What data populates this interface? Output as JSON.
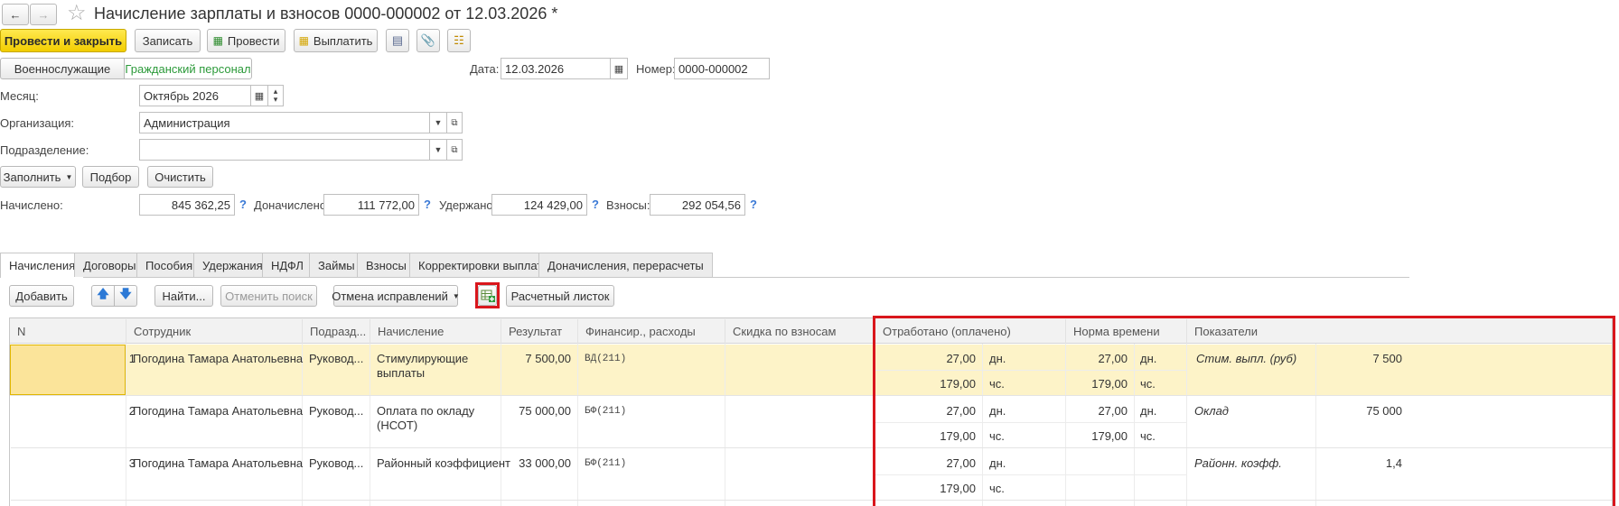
{
  "header": {
    "title": "Начисление зарплаты и взносов 0000-000002 от 12.03.2026 *"
  },
  "toolbar": {
    "post_close": "Провести и закрыть",
    "save": "Записать",
    "post": "Провести",
    "pay": "Выплатить"
  },
  "modes": {
    "military": "Военнослужащие",
    "civil": "Гражданский персонал"
  },
  "doc": {
    "date_label": "Дата:",
    "date_value": "12.03.2026",
    "number_label": "Номер:",
    "number_value": "0000-000002"
  },
  "form": {
    "month_label": "Месяц:",
    "month_value": "Октябрь 2026",
    "org_label": "Организация:",
    "org_value": "Администрация",
    "dept_label": "Подразделение:",
    "dept_value": ""
  },
  "actions": {
    "fill": "Заполнить",
    "select": "Подбор",
    "clear": "Очистить"
  },
  "totals": {
    "accrued_label": "Начислено:",
    "accrued_value": "845 362,25",
    "additional_label": "Доначислено:",
    "additional_value": "111 772,00",
    "withheld_label": "Удержано:",
    "withheld_value": "124 429,00",
    "contrib_label": "Взносы:",
    "contrib_value": "292 054,56",
    "help": "?"
  },
  "tabs": [
    "Начисления",
    "Договоры",
    "Пособия",
    "Удержания",
    "НДФЛ",
    "Займы",
    "Взносы",
    "Корректировки выплаты",
    "Доначисления, перерасчеты"
  ],
  "tabletools": {
    "add": "Добавить",
    "find": "Найти...",
    "cancel_search": "Отменить поиск",
    "cancel_fix": "Отмена исправлений",
    "payslip": "Расчетный листок"
  },
  "columns": [
    "N",
    "Сотрудник",
    "Подразд...",
    "Начисление",
    "Результат",
    "Финансир., расходы",
    "Скидка по взносам",
    "Отработано (оплачено)",
    "Норма времени",
    "Показатели"
  ],
  "rows": [
    {
      "n": "1",
      "employee": "Погодина Тамара Анатольевна",
      "dept": "Руковод...",
      "accrual1": "Стимулирующие",
      "accrual2": "выплаты",
      "result": "7 500,00",
      "fin": "ВД(211)",
      "worked_days": "27,00",
      "days_unit": "дн.",
      "worked_hours": "179,00",
      "hours_unit": "чс.",
      "norm_days": "27,00",
      "norm_days_unit": "дн.",
      "norm_hours": "179,00",
      "norm_hours_unit": "чс.",
      "ind_name": "Стим. выпл. (руб)",
      "ind_value": "7 500"
    },
    {
      "n": "2",
      "employee": "Погодина Тамара Анатольевна",
      "dept": "Руковод...",
      "accrual1": "Оплата по окладу",
      "accrual2": "(НСОТ)",
      "result": "75 000,00",
      "fin": "БФ(211)",
      "worked_days": "27,00",
      "days_unit": "дн.",
      "worked_hours": "179,00",
      "hours_unit": "чс.",
      "norm_days": "27,00",
      "norm_days_unit": "дн.",
      "norm_hours": "179,00",
      "norm_hours_unit": "чс.",
      "ind_name": "Оклад",
      "ind_value": "75 000"
    },
    {
      "n": "3",
      "employee": "Погодина Тамара Анатольевна",
      "dept": "Руковод...",
      "accrual1": "Районный коэффициент",
      "accrual2": "",
      "result": "33 000,00",
      "fin": "БФ(211)",
      "worked_days": "27,00",
      "days_unit": "дн.",
      "worked_hours": "179,00",
      "hours_unit": "чс.",
      "norm_days": "",
      "norm_days_unit": "",
      "norm_hours": "",
      "norm_hours_unit": "",
      "ind_name": "Районн. коэфф.",
      "ind_value": "1,4"
    }
  ],
  "colors": {
    "accent_yellow": "#f2cd00",
    "selected_row": "#fdf3c8",
    "highlight_red": "#d9161c",
    "link_blue": "#3a79d6"
  }
}
